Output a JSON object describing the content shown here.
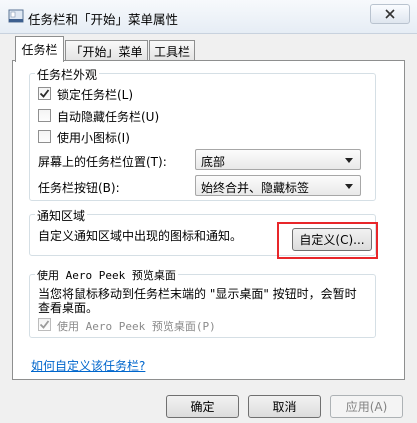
{
  "window": {
    "title": "任务栏和「开始」菜单属性"
  },
  "tabs": [
    {
      "label": "任务栏"
    },
    {
      "label": "「开始」菜单"
    },
    {
      "label": "工具栏"
    }
  ],
  "appearance": {
    "title": "任务栏外观",
    "checkboxes": [
      {
        "label": "锁定任务栏(L)",
        "checked": true
      },
      {
        "label": "自动隐藏任务栏(U)",
        "checked": false
      },
      {
        "label": "使用小图标(I)",
        "checked": false
      }
    ],
    "location": {
      "label": "屏幕上的任务栏位置(T):",
      "value": "底部"
    },
    "buttons_mode": {
      "label": "任务栏按钮(B):",
      "value": "始终合并、隐藏标签"
    }
  },
  "notification": {
    "title": "通知区域",
    "description": "自定义通知区域中出现的图标和通知。",
    "customize_label": "自定义(C)..."
  },
  "aero_peek": {
    "title": "使用 Aero Peek 预览桌面",
    "description_line1": "当您将鼠标移动到任务栏末端的 \"显示桌面\" 按钮时，会暂时",
    "description_line2": "查看桌面。",
    "checkbox_label": "使用 Aero Peek 预览桌面(P)",
    "checkbox_checked": true,
    "checkbox_disabled": true
  },
  "help_link": "如何自定义该任务栏?",
  "footer": {
    "ok_label": "确定",
    "cancel_label": "取消",
    "apply_label": "应用(A)"
  },
  "colors": {
    "highlight": "#e8262a",
    "link": "#0066cc"
  }
}
